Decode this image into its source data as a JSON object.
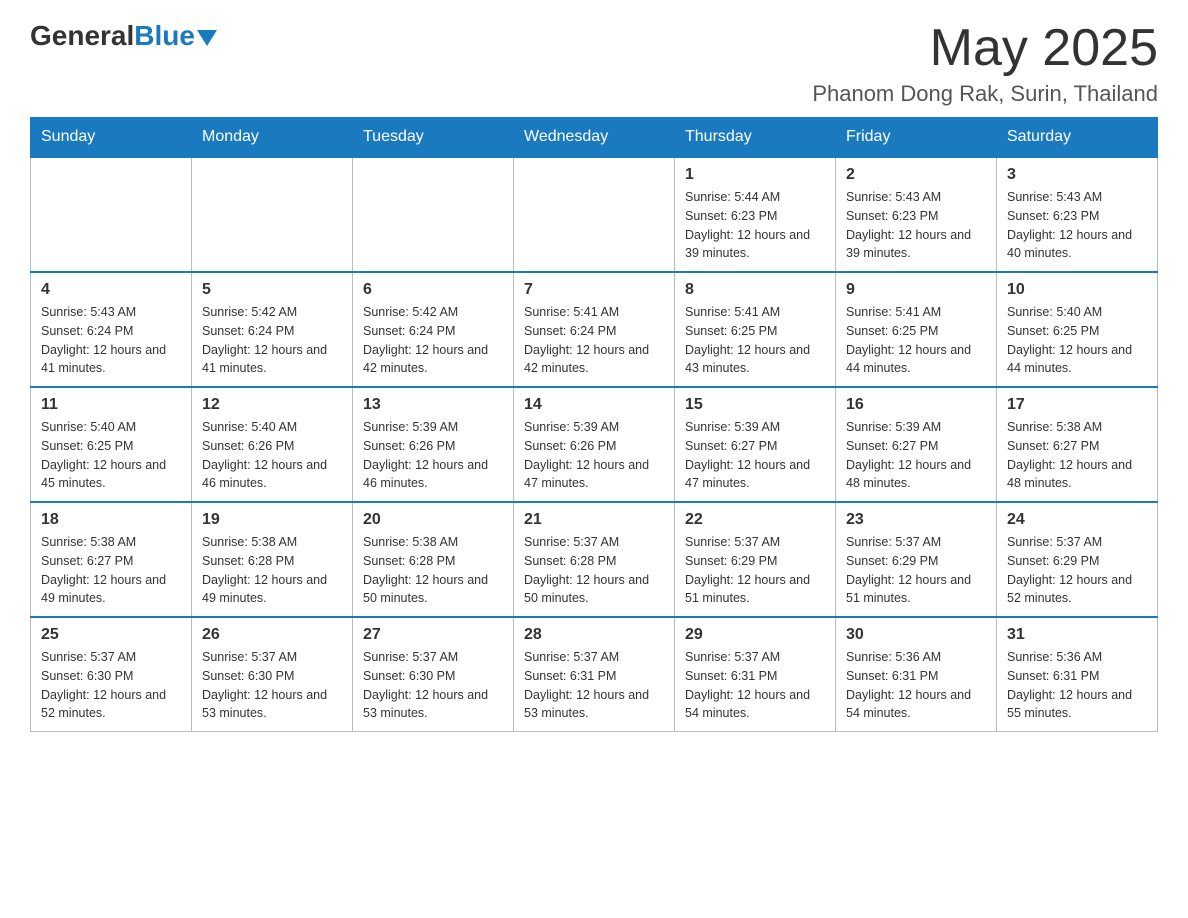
{
  "header": {
    "logo_general": "General",
    "logo_blue": "Blue",
    "month_year": "May 2025",
    "location": "Phanom Dong Rak, Surin, Thailand"
  },
  "days_of_week": [
    "Sunday",
    "Monday",
    "Tuesday",
    "Wednesday",
    "Thursday",
    "Friday",
    "Saturday"
  ],
  "weeks": [
    [
      {
        "day": "",
        "sunrise": "",
        "sunset": "",
        "daylight": ""
      },
      {
        "day": "",
        "sunrise": "",
        "sunset": "",
        "daylight": ""
      },
      {
        "day": "",
        "sunrise": "",
        "sunset": "",
        "daylight": ""
      },
      {
        "day": "",
        "sunrise": "",
        "sunset": "",
        "daylight": ""
      },
      {
        "day": "1",
        "sunrise": "Sunrise: 5:44 AM",
        "sunset": "Sunset: 6:23 PM",
        "daylight": "Daylight: 12 hours and 39 minutes."
      },
      {
        "day": "2",
        "sunrise": "Sunrise: 5:43 AM",
        "sunset": "Sunset: 6:23 PM",
        "daylight": "Daylight: 12 hours and 39 minutes."
      },
      {
        "day": "3",
        "sunrise": "Sunrise: 5:43 AM",
        "sunset": "Sunset: 6:23 PM",
        "daylight": "Daylight: 12 hours and 40 minutes."
      }
    ],
    [
      {
        "day": "4",
        "sunrise": "Sunrise: 5:43 AM",
        "sunset": "Sunset: 6:24 PM",
        "daylight": "Daylight: 12 hours and 41 minutes."
      },
      {
        "day": "5",
        "sunrise": "Sunrise: 5:42 AM",
        "sunset": "Sunset: 6:24 PM",
        "daylight": "Daylight: 12 hours and 41 minutes."
      },
      {
        "day": "6",
        "sunrise": "Sunrise: 5:42 AM",
        "sunset": "Sunset: 6:24 PM",
        "daylight": "Daylight: 12 hours and 42 minutes."
      },
      {
        "day": "7",
        "sunrise": "Sunrise: 5:41 AM",
        "sunset": "Sunset: 6:24 PM",
        "daylight": "Daylight: 12 hours and 42 minutes."
      },
      {
        "day": "8",
        "sunrise": "Sunrise: 5:41 AM",
        "sunset": "Sunset: 6:25 PM",
        "daylight": "Daylight: 12 hours and 43 minutes."
      },
      {
        "day": "9",
        "sunrise": "Sunrise: 5:41 AM",
        "sunset": "Sunset: 6:25 PM",
        "daylight": "Daylight: 12 hours and 44 minutes."
      },
      {
        "day": "10",
        "sunrise": "Sunrise: 5:40 AM",
        "sunset": "Sunset: 6:25 PM",
        "daylight": "Daylight: 12 hours and 44 minutes."
      }
    ],
    [
      {
        "day": "11",
        "sunrise": "Sunrise: 5:40 AM",
        "sunset": "Sunset: 6:25 PM",
        "daylight": "Daylight: 12 hours and 45 minutes."
      },
      {
        "day": "12",
        "sunrise": "Sunrise: 5:40 AM",
        "sunset": "Sunset: 6:26 PM",
        "daylight": "Daylight: 12 hours and 46 minutes."
      },
      {
        "day": "13",
        "sunrise": "Sunrise: 5:39 AM",
        "sunset": "Sunset: 6:26 PM",
        "daylight": "Daylight: 12 hours and 46 minutes."
      },
      {
        "day": "14",
        "sunrise": "Sunrise: 5:39 AM",
        "sunset": "Sunset: 6:26 PM",
        "daylight": "Daylight: 12 hours and 47 minutes."
      },
      {
        "day": "15",
        "sunrise": "Sunrise: 5:39 AM",
        "sunset": "Sunset: 6:27 PM",
        "daylight": "Daylight: 12 hours and 47 minutes."
      },
      {
        "day": "16",
        "sunrise": "Sunrise: 5:39 AM",
        "sunset": "Sunset: 6:27 PM",
        "daylight": "Daylight: 12 hours and 48 minutes."
      },
      {
        "day": "17",
        "sunrise": "Sunrise: 5:38 AM",
        "sunset": "Sunset: 6:27 PM",
        "daylight": "Daylight: 12 hours and 48 minutes."
      }
    ],
    [
      {
        "day": "18",
        "sunrise": "Sunrise: 5:38 AM",
        "sunset": "Sunset: 6:27 PM",
        "daylight": "Daylight: 12 hours and 49 minutes."
      },
      {
        "day": "19",
        "sunrise": "Sunrise: 5:38 AM",
        "sunset": "Sunset: 6:28 PM",
        "daylight": "Daylight: 12 hours and 49 minutes."
      },
      {
        "day": "20",
        "sunrise": "Sunrise: 5:38 AM",
        "sunset": "Sunset: 6:28 PM",
        "daylight": "Daylight: 12 hours and 50 minutes."
      },
      {
        "day": "21",
        "sunrise": "Sunrise: 5:37 AM",
        "sunset": "Sunset: 6:28 PM",
        "daylight": "Daylight: 12 hours and 50 minutes."
      },
      {
        "day": "22",
        "sunrise": "Sunrise: 5:37 AM",
        "sunset": "Sunset: 6:29 PM",
        "daylight": "Daylight: 12 hours and 51 minutes."
      },
      {
        "day": "23",
        "sunrise": "Sunrise: 5:37 AM",
        "sunset": "Sunset: 6:29 PM",
        "daylight": "Daylight: 12 hours and 51 minutes."
      },
      {
        "day": "24",
        "sunrise": "Sunrise: 5:37 AM",
        "sunset": "Sunset: 6:29 PM",
        "daylight": "Daylight: 12 hours and 52 minutes."
      }
    ],
    [
      {
        "day": "25",
        "sunrise": "Sunrise: 5:37 AM",
        "sunset": "Sunset: 6:30 PM",
        "daylight": "Daylight: 12 hours and 52 minutes."
      },
      {
        "day": "26",
        "sunrise": "Sunrise: 5:37 AM",
        "sunset": "Sunset: 6:30 PM",
        "daylight": "Daylight: 12 hours and 53 minutes."
      },
      {
        "day": "27",
        "sunrise": "Sunrise: 5:37 AM",
        "sunset": "Sunset: 6:30 PM",
        "daylight": "Daylight: 12 hours and 53 minutes."
      },
      {
        "day": "28",
        "sunrise": "Sunrise: 5:37 AM",
        "sunset": "Sunset: 6:31 PM",
        "daylight": "Daylight: 12 hours and 53 minutes."
      },
      {
        "day": "29",
        "sunrise": "Sunrise: 5:37 AM",
        "sunset": "Sunset: 6:31 PM",
        "daylight": "Daylight: 12 hours and 54 minutes."
      },
      {
        "day": "30",
        "sunrise": "Sunrise: 5:36 AM",
        "sunset": "Sunset: 6:31 PM",
        "daylight": "Daylight: 12 hours and 54 minutes."
      },
      {
        "day": "31",
        "sunrise": "Sunrise: 5:36 AM",
        "sunset": "Sunset: 6:31 PM",
        "daylight": "Daylight: 12 hours and 55 minutes."
      }
    ]
  ]
}
